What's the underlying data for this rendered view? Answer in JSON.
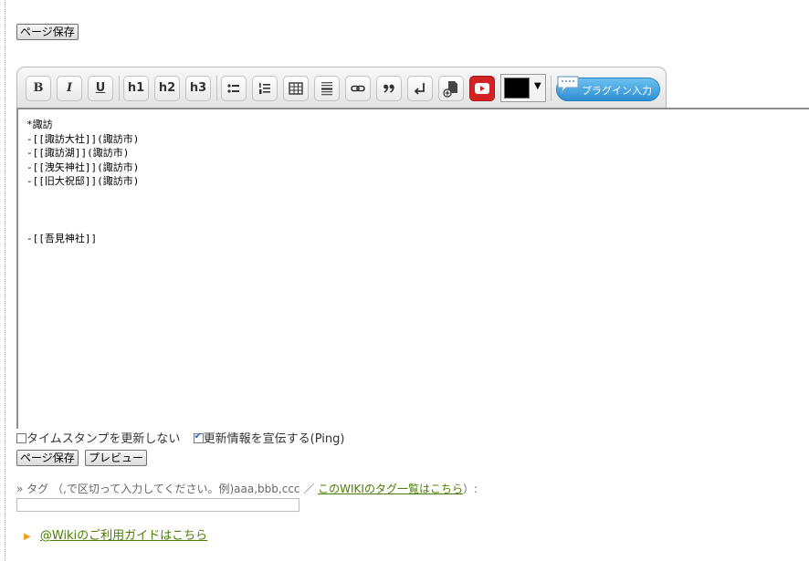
{
  "top": {
    "save_label": "ページ保存"
  },
  "toolbar": {
    "buttons": [
      "B",
      "I",
      "U",
      "h1",
      "h2",
      "h3"
    ],
    "plugin_label": "プラグイン入力",
    "color_swatch": "#000000"
  },
  "editor": {
    "lines": [
      "*諏訪",
      "-[[諏訪大社]](諏訪市)",
      "-[[諏訪湖]](諏訪市)",
      "-[[洩矢神社]](諏訪市)",
      "-[[旧大祝邸]](諏訪市)",
      "",
      "",
      "",
      "-[[吾見神社]]"
    ]
  },
  "options": {
    "no_timestamp_label": "タイムスタンプを更新しない",
    "ping_label": "更新情報を宣伝する(Ping)",
    "no_timestamp_checked": false,
    "ping_checked": true
  },
  "actions": {
    "save_label": "ページ保存",
    "preview_label": "プレビュー"
  },
  "tags": {
    "prefix": "» タグ",
    "hint": "（,で区切って入力してください。例)aaa,bbb,ccc ／",
    "list_link": "このWIKIのタグ一覧はこちら",
    "suffix": "）:",
    "value": ""
  },
  "guide": {
    "link": "@Wikiのご利用ガイドはこちら"
  },
  "colors": {
    "link": "#4a7d00",
    "youtube": "#d32222",
    "plugin": "#3a9ad9",
    "guide_arrow": "#f0a020"
  }
}
